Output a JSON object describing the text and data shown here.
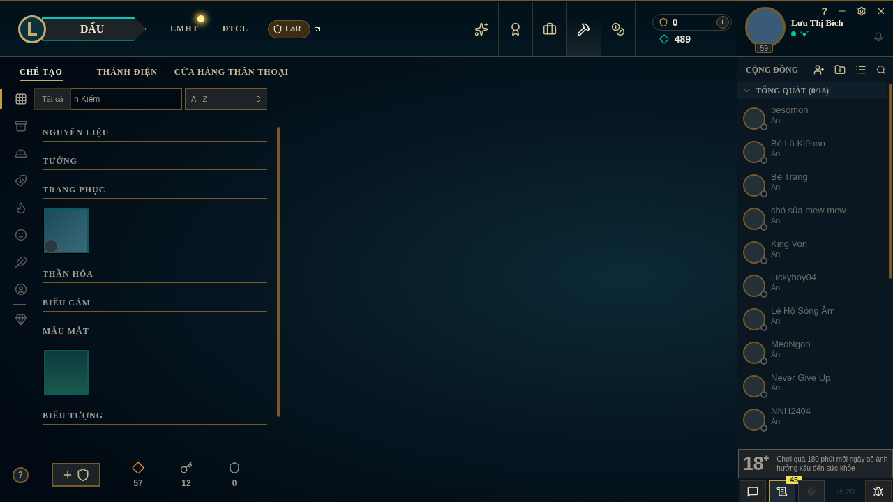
{
  "header": {
    "play_button": "ĐẤU",
    "nav_links": [
      {
        "label": "LMHT",
        "notification": true
      },
      {
        "label": "ĐTCL",
        "notification": false
      }
    ],
    "lor_button": "LoR",
    "nav_icons": [
      {
        "kind": "emblem",
        "selected": false
      },
      {
        "kind": "trophy",
        "selected": false
      },
      {
        "kind": "bag",
        "selected": false
      },
      {
        "kind": "crafting",
        "selected": false,
        "highlight": true
      },
      {
        "kind": "store",
        "selected": false
      }
    ],
    "currency": {
      "rp": "0",
      "blue_essence": "489"
    }
  },
  "profile": {
    "name": "Lưu Thị Bích",
    "status": "“♥”",
    "level": "59",
    "help": "?"
  },
  "subtabs": [
    {
      "label": "CHẾ TẠO",
      "selected": true
    },
    {
      "label": "THÁNH ĐIỆN",
      "selected": false
    },
    {
      "label": "CỬA HÀNG THẦN THOẠI",
      "selected": false
    }
  ],
  "filter_rail": [
    {
      "kind": "all",
      "selected": true
    },
    {
      "kind": "chest",
      "selected": false
    },
    {
      "kind": "champion",
      "selected": false
    },
    {
      "kind": "skin",
      "selected": false
    },
    {
      "kind": "flame",
      "selected": false
    },
    {
      "kind": "emote",
      "selected": false
    },
    {
      "kind": "ward",
      "selected": false
    },
    {
      "kind": "icon",
      "selected": false
    },
    {
      "kind": "other",
      "selected": false
    }
  ],
  "tooltip": "Tất cả",
  "search": {
    "placeholder": "n Kiếm"
  },
  "sort": {
    "value": "A - Z"
  },
  "categories": [
    {
      "title": "NGUYÊN LIỆU"
    },
    {
      "title": "TƯỚNG"
    },
    {
      "title": "TRANG PHỤC",
      "items": [
        {
          "kind": "skin"
        }
      ]
    },
    {
      "title": "THẦN HỎA"
    },
    {
      "title": "BIỂU CẢM"
    },
    {
      "title": "MẪU MẮT",
      "items": [
        {
          "kind": "ward"
        }
      ]
    },
    {
      "title": "BIỂU TƯỢNG"
    }
  ],
  "footer": {
    "help": "?",
    "counts": [
      {
        "kind": "essence",
        "value": "57"
      },
      {
        "kind": "key",
        "value": "12"
      },
      {
        "kind": "chest",
        "value": "0"
      }
    ]
  },
  "social": {
    "title": "CỘNG ĐỒNG",
    "group": {
      "label": "TỔNG QUÁT (0/18)",
      "expanded": true
    },
    "friends": [
      {
        "name": "besomon",
        "status": "Ẩn"
      },
      {
        "name": "Bé Là Kiênnn",
        "status": "Ẩn"
      },
      {
        "name": "Bé Trang",
        "status": "Ẩn"
      },
      {
        "name": "chó sủa mew mew",
        "status": "Ẩn"
      },
      {
        "name": "King Von",
        "status": "Ẩn"
      },
      {
        "name": "luckyboy04",
        "status": "Ẩn"
      },
      {
        "name": "Lé Hộ Sóng Âm",
        "status": "Ẩn"
      },
      {
        "name": "MeoNgoo",
        "status": "Ẩn"
      },
      {
        "name": "Never Give Up",
        "status": "Ẩn"
      },
      {
        "name": "NNH2404",
        "status": "Ẩn"
      }
    ]
  },
  "age_notice": {
    "badge": "18",
    "plus": "+",
    "text": "Chơi quá 180 phút mỗi ngày sẽ ảnh hưởng xấu đến sức khỏe"
  },
  "bottom_bar": {
    "missions_badge": "45",
    "mic_disabled": true,
    "version": "25.20"
  }
}
